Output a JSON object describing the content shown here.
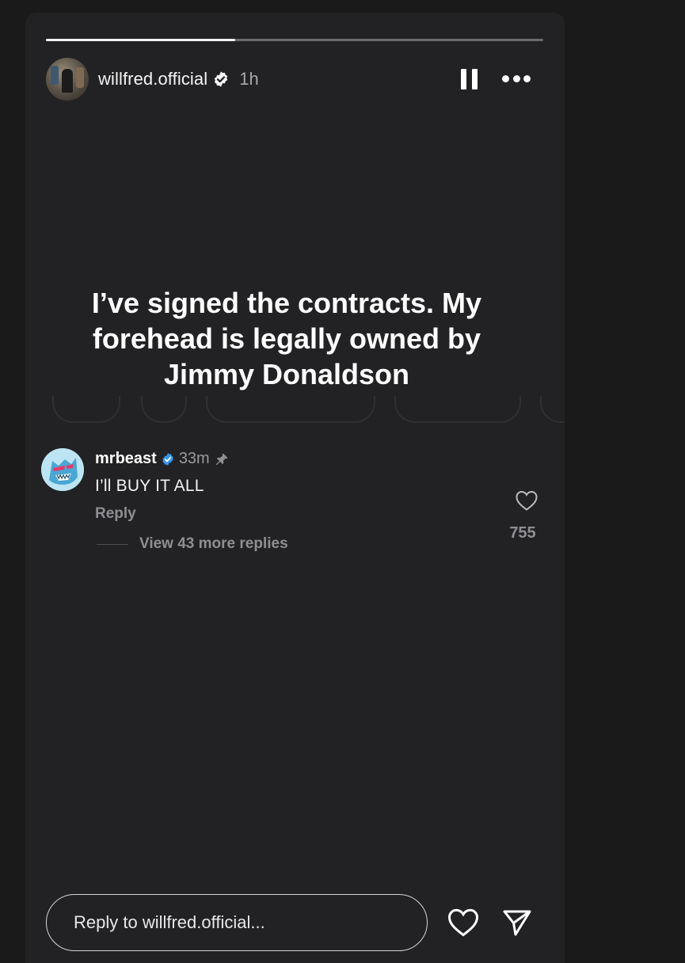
{
  "story": {
    "progress": 0.38,
    "username": "willfred.official",
    "time_ago": "1h",
    "text": "I’ve signed the contracts. My forehead is legally owned by Jimmy Donaldson"
  },
  "comment": {
    "username": "mrbeast",
    "time_ago": "33m",
    "text": "I’ll BUY IT ALL",
    "reply_label": "Reply",
    "likes": "755",
    "view_replies": "View 43 more replies"
  },
  "footer": {
    "reply_placeholder": "Reply to willfred.official..."
  },
  "colors": {
    "background": "#1a1a1b",
    "story_bg": "#222224",
    "verified": "#3897f0",
    "muted_text": "#8f8f93"
  },
  "icons": [
    "verified-icon",
    "pause-icon",
    "more-icon",
    "pin-icon",
    "like-icon",
    "heart-icon",
    "send-icon"
  ]
}
